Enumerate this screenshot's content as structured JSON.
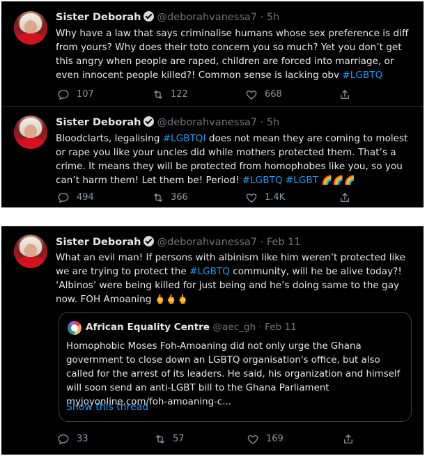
{
  "tweets": [
    {
      "name": "Sister Deborah",
      "handle": "@deborahvanessa7",
      "time": "· 5h",
      "text_parts": [
        "Why have a law that says criminalise humans whose sex preference is diff from yours? Why does their toto concern you so much? Yet you don’t get this angry when people are raped, children are forced into marriage, or even innocent people killed?! Common sense is lacking obv ",
        "#LGBTQ"
      ],
      "replies": "107",
      "retweets": "122",
      "likes": "668"
    },
    {
      "name": "Sister Deborah",
      "handle": "@deborahvanessa7",
      "time": "· 5h",
      "text_parts": [
        "Bloodclarts, legalising ",
        "#LGBTQI",
        " does not mean they are coming to molest or rape you like your uncles did while mothers protected them. That’s a crime. It means they will be protected from homophobes like you, so you can’t harm them! Let them be! Period! ",
        "#LGBTQ",
        " ",
        "#LGBT",
        " 🌈🌈🌈"
      ],
      "replies": "494",
      "retweets": "366",
      "likes": "1.4K"
    },
    {
      "name": "Sister Deborah",
      "handle": "@deborahvanessa7",
      "time": "· Feb 11",
      "text_parts": [
        "What an evil man! If persons with albinism like him weren’t protected like we are trying to protect the ",
        "#LGBTQ",
        " community, will he be alive today?! ‘Albinos’ were being killed for just being and he’s doing same to the gay now. FOH Amoaning ",
        "🖕🖕🖕"
      ],
      "replies": "33",
      "retweets": "57",
      "likes": "169",
      "quote": {
        "name": "African Equality Centre",
        "handle": "@aec_gh",
        "time": "· Feb 11",
        "text": "Homophobic Moses Foh-Amoaning did not only urge the Ghana government to close down an LGBTQ organisation's office, but also called for the arrest of its leaders. He said, his organization and himself will soon send an anti-LGBT bill to the Ghana Parliament myjoyonline.com/foh-amoaning-c...",
        "show_thread": "Show this thread"
      }
    }
  ],
  "icons": {
    "reply": "reply-icon",
    "retweet": "retweet-icon",
    "like": "like-icon",
    "share": "share-icon",
    "verified": "verified-badge-icon"
  },
  "colors": {
    "background": "#000000",
    "text": "#e7e9ea",
    "muted": "#6e767d",
    "link": "#1d9bf0",
    "divider": "#2f3336"
  }
}
